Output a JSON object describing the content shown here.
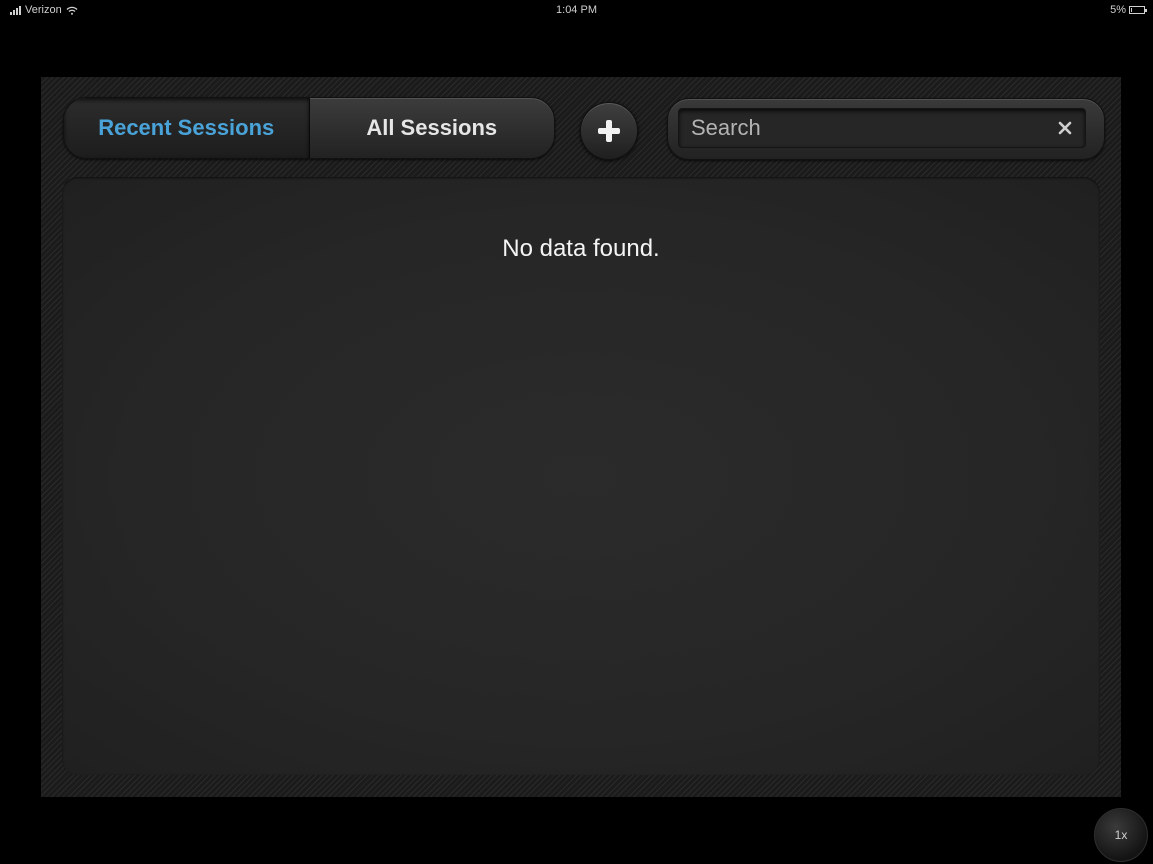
{
  "status_bar": {
    "carrier": "Verizon",
    "time": "1:04 PM",
    "battery_text": "5%",
    "battery_level": 0.05
  },
  "tabs": [
    {
      "label": "Recent Sessions",
      "selected": true
    },
    {
      "label": "All Sessions",
      "selected": false
    }
  ],
  "add_button": {
    "icon": "plus-icon"
  },
  "search": {
    "placeholder": "Search",
    "value": "",
    "clear_icon": "close-icon"
  },
  "content": {
    "empty_message": "No data found."
  },
  "speed_button": {
    "label": "1x"
  },
  "colors": {
    "accent": "#4aa3d8",
    "background": "#000000",
    "panel": "#1e1e1e"
  }
}
